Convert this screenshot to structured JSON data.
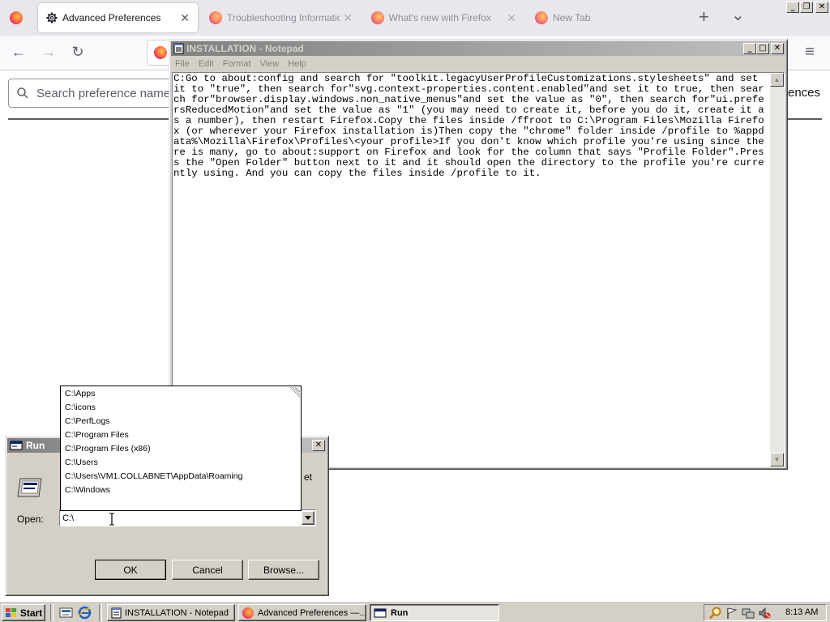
{
  "browser": {
    "tabs": [
      {
        "label": "Advanced Preferences",
        "active": true
      },
      {
        "label": "Troubleshooting Information",
        "active": false
      },
      {
        "label": "What's new with Firefox",
        "active": false
      },
      {
        "label": "New Tab",
        "active": false
      }
    ],
    "new_tab_symbol": "+",
    "tab_list_symbol": "⌄",
    "menu_symbol": "≡"
  },
  "preferences": {
    "search_placeholder": "Search preference name",
    "right_text": "ences"
  },
  "notepad": {
    "title": "INSTALLATION - Notepad",
    "menu": [
      "File",
      "Edit",
      "Format",
      "View",
      "Help"
    ],
    "content": "C:Go to about:config and search for \"toolkit.legacyUserProfileCustomizations.stylesheets\" and set it to \"true\", then search for\"svg.context-properties.content.enabled\"and set it to true, then search for\"browser.display.windows.non_native_menus\"and set the value as \"0\", then search for\"ui.prefersReducedMotion\"and set the value as \"1\" (you may need to create it, before you do it, create it as a number), then restart Firefox.Copy the files inside /ffroot to C:\\Program Files\\Mozilla Firefox (or wherever your Firefox installation is)Then copy the \"chrome\" folder inside /profile to %appdata%\\Mozilla\\Firefox\\Profiles\\<your profile>If you don't know which profile you're using since there is many, go to about:support on Firefox and look for the column that says \"Profile Folder\".Press the \"Open Folder\" button next to it and it should open the directory to the profile you're currently using. And you can copy the files inside /profile to it."
  },
  "run_dialog": {
    "title": "Run",
    "description_fragment": "et",
    "open_label": "Open:",
    "open_value": "C:\\",
    "ok_label": "OK",
    "cancel_label": "Cancel",
    "browse_label": "Browse...",
    "autocomplete": [
      "C:\\Apps",
      "C:\\icons",
      "C:\\PerfLogs",
      "C:\\Program Files",
      "C:\\Program Files (x86)",
      "C:\\Users",
      "C:\\Users\\VM1.COLLABNET\\AppData\\Roaming",
      "C:\\Windows"
    ]
  },
  "taskbar": {
    "start_label": "Start",
    "items": [
      {
        "label": "INSTALLATION - Notepad",
        "pressed": false
      },
      {
        "label": "Advanced Preferences —...",
        "pressed": false
      },
      {
        "label": "Run",
        "pressed": true
      }
    ],
    "clock": "8:13 AM"
  }
}
